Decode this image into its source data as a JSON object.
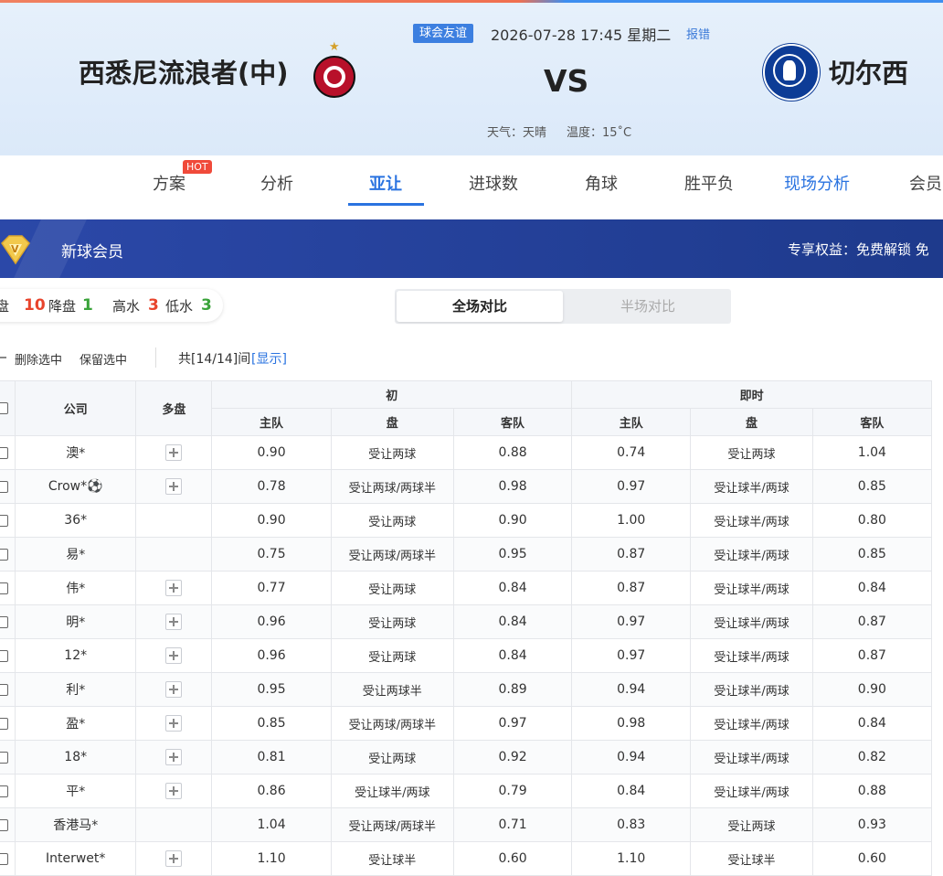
{
  "match": {
    "home_team": "西悉尼流浪者(中)",
    "away_team": "切尔西",
    "tag": "球会友谊",
    "datetime": "2026-07-28 17:45 星期二",
    "report_label": "报错",
    "vs": "VS",
    "weather": "天气：天晴",
    "temperature": "温度：15˚C",
    "colors": {
      "home": "#b8102a",
      "away": "#0d3c96"
    }
  },
  "tabs": [
    {
      "label": "方案",
      "badge": "HOT"
    },
    {
      "label": "分析"
    },
    {
      "label": "亚让",
      "active": true
    },
    {
      "label": "进球数"
    },
    {
      "label": "角球"
    },
    {
      "label": "胜平负"
    },
    {
      "label": "现场分析"
    },
    {
      "label": "会员"
    }
  ],
  "member": {
    "title": "新球会员",
    "rights": "专享权益：免费解锁 免"
  },
  "stats": {
    "up_label": "升盘",
    "up_value": "10",
    "down_label": "降盘",
    "down_value": "1",
    "high_label": "高水",
    "high_value": "3",
    "low_label": "低水",
    "low_value": "3"
  },
  "toggle": {
    "full": "全场对比",
    "half": "半场对比"
  },
  "actions": {
    "delete_selected": "删除选中",
    "keep_selected": "保留选中",
    "count_text": "共[14/14]间",
    "show_label": "[显示]"
  },
  "table": {
    "headers": {
      "company": "公司",
      "multi": "多盘",
      "initial": "初",
      "live": "即时",
      "home": "主队",
      "handicap": "盘",
      "away": "客队"
    },
    "rows": [
      {
        "company": "澳*",
        "multi": true,
        "init_home": "0.90",
        "init_pan": "受让两球",
        "init_away": "0.88",
        "live_home": "0.74",
        "live_pan": "受让两球",
        "live_away": "1.04"
      },
      {
        "company": "Crow*⚽",
        "multi": true,
        "init_home": "0.78",
        "init_pan": "受让两球/两球半",
        "init_away": "0.98",
        "live_home": "0.97",
        "live_pan": "受让球半/两球",
        "live_away": "0.85"
      },
      {
        "company": "36*",
        "multi": false,
        "init_home": "0.90",
        "init_pan": "受让两球",
        "init_away": "0.90",
        "live_home": "1.00",
        "live_pan": "受让球半/两球",
        "live_away": "0.80"
      },
      {
        "company": "易*",
        "multi": false,
        "init_home": "0.75",
        "init_pan": "受让两球/两球半",
        "init_away": "0.95",
        "live_home": "0.87",
        "live_pan": "受让球半/两球",
        "live_away": "0.85"
      },
      {
        "company": "伟*",
        "multi": true,
        "init_home": "0.77",
        "init_pan": "受让两球",
        "init_away": "0.84",
        "live_home": "0.87",
        "live_pan": "受让球半/两球",
        "live_away": "0.84"
      },
      {
        "company": "明*",
        "multi": true,
        "init_home": "0.96",
        "init_pan": "受让两球",
        "init_away": "0.84",
        "live_home": "0.97",
        "live_pan": "受让球半/两球",
        "live_away": "0.87"
      },
      {
        "company": "12*",
        "multi": true,
        "init_home": "0.96",
        "init_pan": "受让两球",
        "init_away": "0.84",
        "live_home": "0.97",
        "live_pan": "受让球半/两球",
        "live_away": "0.87"
      },
      {
        "company": "利*",
        "multi": true,
        "init_home": "0.95",
        "init_pan": "受让两球半",
        "init_away": "0.89",
        "live_home": "0.94",
        "live_pan": "受让球半/两球",
        "live_away": "0.90"
      },
      {
        "company": "盈*",
        "multi": true,
        "init_home": "0.85",
        "init_pan": "受让两球/两球半",
        "init_away": "0.97",
        "live_home": "0.98",
        "live_pan": "受让球半/两球",
        "live_away": "0.84"
      },
      {
        "company": "18*",
        "multi": true,
        "init_home": "0.81",
        "init_pan": "受让两球",
        "init_away": "0.92",
        "live_home": "0.94",
        "live_pan": "受让球半/两球",
        "live_away": "0.82"
      },
      {
        "company": "平*",
        "multi": true,
        "init_home": "0.86",
        "init_pan": "受让球半/两球",
        "init_away": "0.79",
        "live_home": "0.84",
        "live_pan": "受让球半/两球",
        "live_away": "0.88"
      },
      {
        "company": "香港马*",
        "multi": false,
        "init_home": "1.04",
        "init_pan": "受让两球/两球半",
        "init_away": "0.71",
        "live_home": "0.83",
        "live_pan": "受让两球",
        "live_away": "0.93"
      },
      {
        "company": "Interwet*",
        "multi": true,
        "init_home": "1.10",
        "init_pan": "受让球半",
        "init_away": "0.60",
        "live_home": "1.10",
        "live_pan": "受让球半",
        "live_away": "0.60"
      }
    ]
  }
}
